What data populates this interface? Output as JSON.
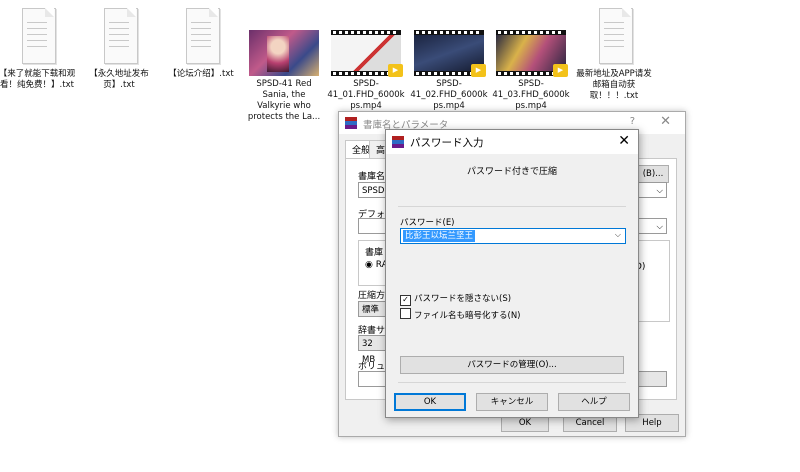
{
  "desktop_files": [
    {
      "name": "【来了就能下载和观看！纯免费！】.txt",
      "type": "txt"
    },
    {
      "name": "【永久地址发布页】.txt",
      "type": "txt"
    },
    {
      "name": "【论坛介绍】.txt",
      "type": "txt"
    },
    {
      "name": "SPSD-41 Red Sania, the Valkyrie who protects the La...",
      "type": "image"
    },
    {
      "name": "SPSD-41_01.FHD_6000kps.mp4",
      "type": "video"
    },
    {
      "name": "SPSD-41_02.FHD_6000kps.mp4",
      "type": "video"
    },
    {
      "name": "SPSD-41_03.FHD_6000kps.mp4",
      "type": "video"
    },
    {
      "name": "最新地址及APP请发邮箱自动获取！！！.txt",
      "type": "txt"
    }
  ],
  "archive_dialog": {
    "title": "書庫名とパラメータ",
    "help_glyph": "?",
    "close_glyph": "✕",
    "tabs": [
      "全般",
      "高"
    ],
    "archive_name_label": "書庫名",
    "archive_name_value": "SPSD-",
    "browse_label": "(B)...",
    "default_label": "デフォル",
    "format_label": "書庫",
    "format_option": "RA",
    "method_label": "圧縮方",
    "method_value": "標準",
    "dict_label": "辞書サ",
    "dict_value": "32 MB",
    "volume_label": "ボリュー",
    "right_fragment": "D)",
    "ok_label": "OK",
    "cancel_label": "Cancel",
    "help_label": "Help"
  },
  "password_dialog": {
    "title": "パスワード入力",
    "close_glyph": "✕",
    "subtitle": "パスワード付きで圧縮",
    "password_label": "パスワード(E)",
    "password_value": "比彭王以坛兰坚王",
    "show_password_label": "パスワードを隠さない(S)",
    "show_password_checked": true,
    "encrypt_names_label": "ファイル名も暗号化する(N)",
    "encrypt_names_checked": false,
    "manage_label": "パスワードの管理(O)...",
    "ok_label": "OK",
    "cancel_label": "キャンセル",
    "help_label": "ヘルプ"
  }
}
